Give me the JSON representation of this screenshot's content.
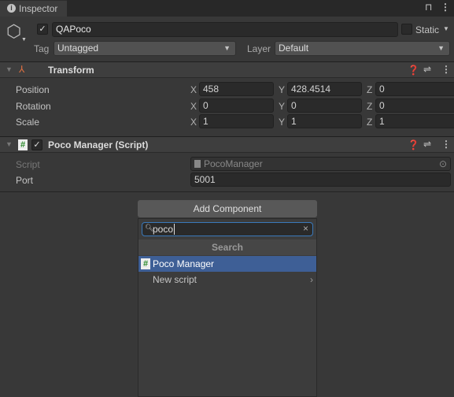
{
  "tab": {
    "title": "Inspector"
  },
  "object": {
    "name": "QAPoco",
    "active": true,
    "static_label": "Static",
    "tag_label": "Tag",
    "tag_value": "Untagged",
    "layer_label": "Layer",
    "layer_value": "Default"
  },
  "transform": {
    "title": "Transform",
    "rows": [
      {
        "label": "Position",
        "x": "458",
        "y": "428.4514",
        "z": "0"
      },
      {
        "label": "Rotation",
        "x": "0",
        "y": "0",
        "z": "0"
      },
      {
        "label": "Scale",
        "x": "1",
        "y": "1",
        "z": "1"
      }
    ],
    "axes": {
      "x": "X",
      "y": "Y",
      "z": "Z"
    }
  },
  "script_component": {
    "title": "Poco Manager (Script)",
    "enabled": true,
    "script_label": "Script",
    "script_value": "PocoManager",
    "port_label": "Port",
    "port_value": "5001"
  },
  "add_component": {
    "button": "Add Component",
    "search_value": "poco",
    "section": "Search",
    "items": [
      {
        "label": "Poco Manager",
        "selected": true
      },
      {
        "label": "New script"
      }
    ]
  },
  "colors": {
    "selection": "#3e5f96",
    "background": "#383838"
  }
}
